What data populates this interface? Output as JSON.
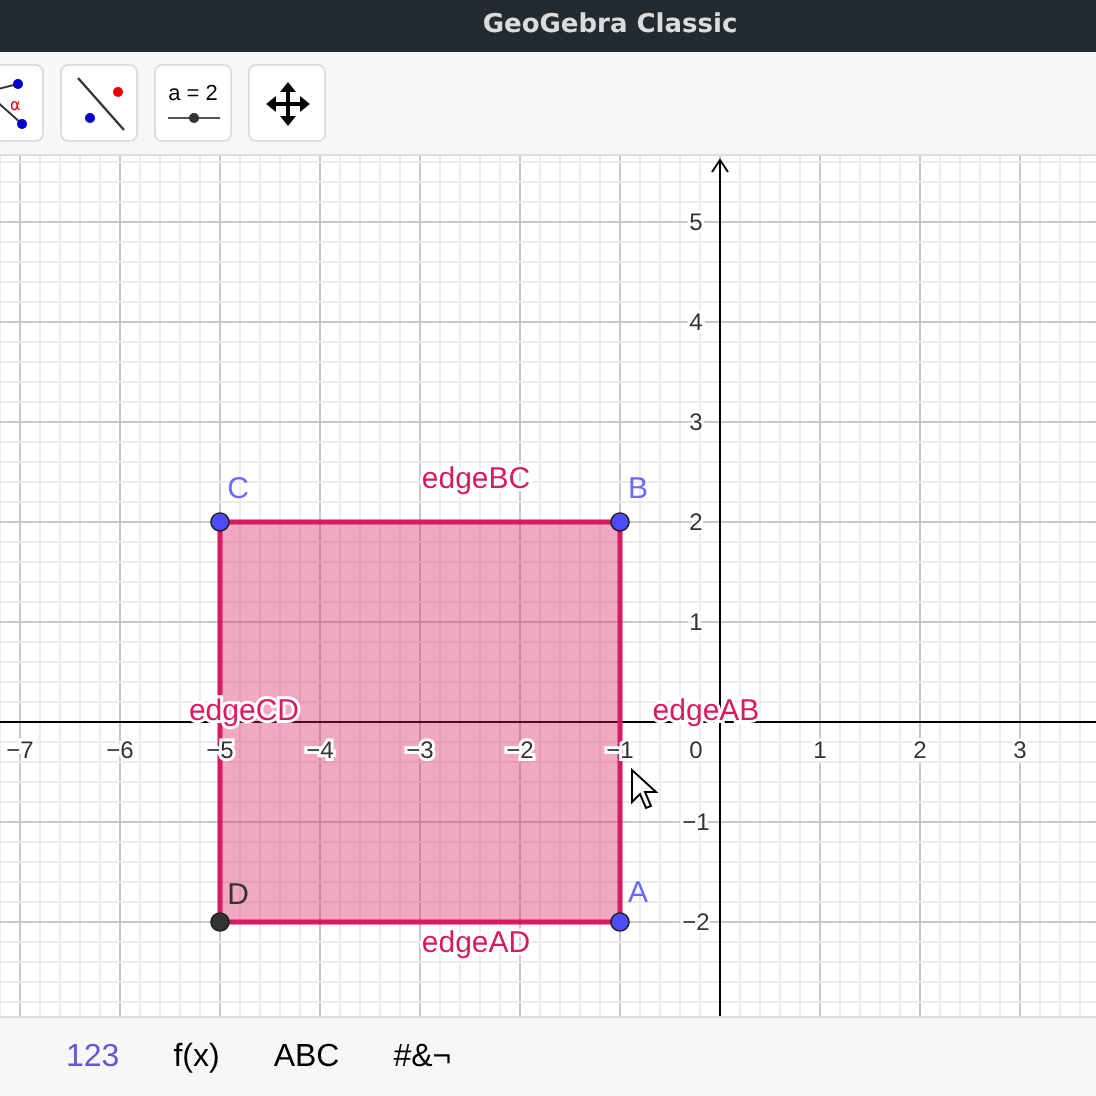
{
  "window": {
    "title": "GeoGebra Classic"
  },
  "toolbar": [
    {
      "kind": "angle",
      "text": "α",
      "selected": false
    },
    {
      "kind": "line",
      "selected": false
    },
    {
      "kind": "slider",
      "text": "a = 2",
      "selected": false
    },
    {
      "kind": "move",
      "selected": false
    }
  ],
  "graphics": {
    "x_tick_labels": [
      "−7",
      "−6",
      "−5",
      "−4",
      "−3",
      "−2",
      "−1",
      "1",
      "2",
      "3"
    ],
    "origin_label": "0",
    "y_tick_labels": [
      "5",
      "4",
      "3",
      "2",
      "1",
      "−1",
      "−2"
    ],
    "points": [
      {
        "label": "C",
        "color": "#4d4dff"
      },
      {
        "label": "B",
        "color": "#4d4dff"
      },
      {
        "label": "D",
        "color": "#333333"
      },
      {
        "label": "A",
        "color": "#4d4dff"
      }
    ],
    "edge_labels": [
      "edgeBC",
      "edgeCD",
      "edgeAB",
      "edgeAD"
    ]
  },
  "keyboard_tabs": [
    {
      "label": "123",
      "selected": true
    },
    {
      "label": "f(x)",
      "selected": false
    },
    {
      "label": "ABC",
      "selected": false
    },
    {
      "label": "#&¬",
      "selected": false
    }
  ]
}
